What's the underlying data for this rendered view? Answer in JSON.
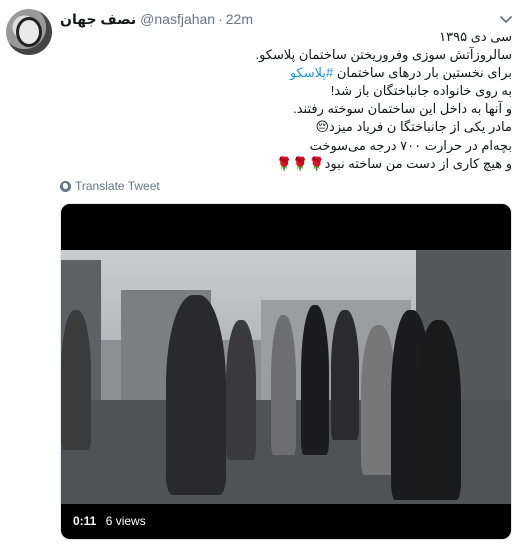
{
  "author": {
    "name": "نصف جهان",
    "handle": "@nasfjahan",
    "separator": "·",
    "time": "22m"
  },
  "icons": {
    "avatar": "profile-avatar",
    "menu": "chevron-down-icon",
    "translate": "globe-icon"
  },
  "colors": {
    "text": "#14171a",
    "secondary": "#657786",
    "link": "#1b95e0"
  },
  "tweet": {
    "line1": "سی دی ۱۳۹۵",
    "line2": "سالروزآتش سوزی وفروریختن ساختمان پلاسکو.",
    "line3_before": "برای نخستین بار درهای ساختمان ",
    "line3_hashtag": "#پلاسکو",
    "line4": "به روی خانواده جانباختگان باز شد!",
    "line5": "و آنها به داخل این ساختمان سوخته رفتند.",
    "line6": "مادر یکی از جانباختگا ن فریاد میزد😔",
    "line7": "بچه‌ام در حرارت ۷۰۰ درجه می‌سوخت",
    "line8": "و هیچ کاری از دست من ساخته نبود🌹🌹🌹"
  },
  "translate_label": "Translate Tweet",
  "video": {
    "timecode": "0:11",
    "views": "6 views"
  }
}
